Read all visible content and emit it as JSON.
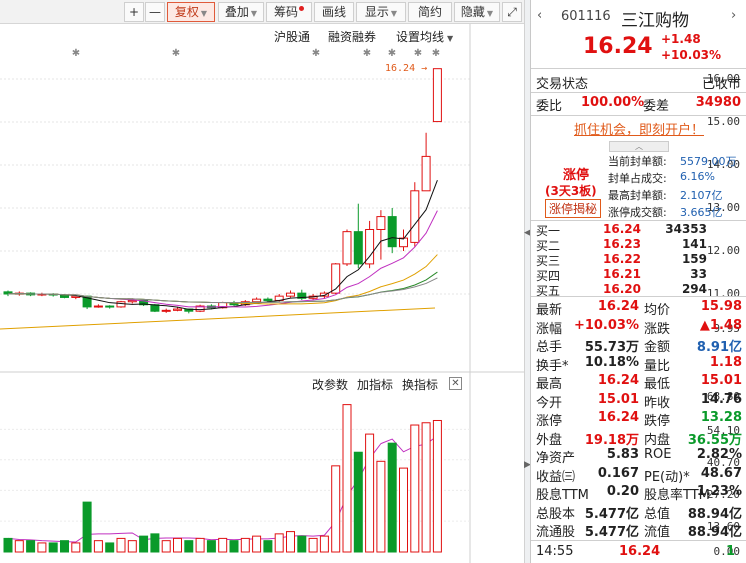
{
  "toolbar": {
    "plus": "+",
    "minus": "—",
    "fuquan": "复权",
    "diejia": "叠加",
    "chouma": "筹码",
    "huaxian": "画线",
    "xianshi": "显示",
    "jianyue": "简约",
    "yincang": "隐藏",
    "expand": "⤢"
  },
  "chart_links": {
    "hgt": "沪股通",
    "rzrq": "融资融券",
    "avg_setting": "设置均线"
  },
  "price_axis": [
    "16.00",
    "15.00",
    "14.00",
    "13.00",
    "12.00",
    "11.00",
    "9.95"
  ],
  "max_price_label": "16.24",
  "volume_buttons": {
    "params": "改参数",
    "add": "加指标",
    "change": "换指标",
    "close": "✕"
  },
  "volume_axis": [
    "68.80",
    "54.10",
    "40.70",
    "27.20",
    "13.60",
    "0.00"
  ],
  "stock": {
    "code": "601116",
    "name": "三江购物",
    "price": "16.24",
    "change": "+1.48",
    "change_pct": "+10.03%"
  },
  "status": {
    "label": "交易状态",
    "value": "已收市"
  },
  "weibi": {
    "label1": "委比",
    "value1": "100.00%",
    "label2": "委差",
    "value2": "34980"
  },
  "promo": "抓住机会，即刻开户！",
  "limit": {
    "tag": "涨停",
    "board": "(3天3板)",
    "reveal": "涨停揭秘",
    "items": [
      {
        "label": "当前封单额:",
        "value": "5579.00万"
      },
      {
        "label": "封单占成交:",
        "value": "6.16%"
      },
      {
        "label": "最高封单额:",
        "value": "2.107亿"
      },
      {
        "label": "涨停成交额:",
        "value": "3.665亿"
      }
    ]
  },
  "bids": [
    {
      "label": "买一",
      "price": "16.24",
      "vol": "34353"
    },
    {
      "label": "买二",
      "price": "16.23",
      "vol": "141"
    },
    {
      "label": "买三",
      "price": "16.22",
      "vol": "159"
    },
    {
      "label": "买四",
      "price": "16.21",
      "vol": "33"
    },
    {
      "label": "买五",
      "price": "16.20",
      "vol": "294"
    }
  ],
  "quote": [
    {
      "l1": "最新",
      "v1": "16.24",
      "c1": "red",
      "l2": "均价",
      "v2": "15.98",
      "c2": "red"
    },
    {
      "l1": "涨幅",
      "v1": "+10.03%",
      "c1": "red",
      "l2": "涨跌",
      "v2": "▲1.48",
      "c2": "red"
    },
    {
      "l1": "总手",
      "v1": "55.73万",
      "c1": "",
      "l2": "金额",
      "v2": "8.91亿",
      "c2": "blu"
    },
    {
      "l1": "换手*",
      "v1": "10.18%",
      "c1": "",
      "l2": "量比",
      "v2": "1.18",
      "c2": "red"
    },
    {
      "l1": "最高",
      "v1": "16.24",
      "c1": "red",
      "l2": "最低",
      "v2": "15.01",
      "c2": "red"
    },
    {
      "l1": "今开",
      "v1": "15.01",
      "c1": "red",
      "l2": "昨收",
      "v2": "14.76",
      "c2": ""
    },
    {
      "l1": "涨停",
      "v1": "16.24",
      "c1": "red",
      "l2": "跌停",
      "v2": "13.28",
      "c2": "grn"
    },
    {
      "l1": "外盘",
      "v1": "19.18万",
      "c1": "red",
      "l2": "内盘",
      "v2": "36.55万",
      "c2": "grn"
    },
    {
      "l1": "净资产",
      "v1": "5.83",
      "c1": "",
      "l2": "ROE",
      "v2": "2.82%",
      "c2": ""
    },
    {
      "l1": "收益㈢",
      "v1": "0.167",
      "c1": "",
      "l2": "PE(动)*",
      "v2": "48.67",
      "c2": ""
    },
    {
      "l1": "股息TTM",
      "v1": "0.20",
      "c1": "",
      "l2": "股息率TTM",
      "v2": "1.23%",
      "c2": ""
    },
    {
      "l1": "总股本",
      "v1": "5.477亿",
      "c1": "",
      "l2": "总值",
      "v2": "88.94亿",
      "c2": ""
    },
    {
      "l1": "流通股",
      "v1": "5.477亿",
      "c1": "",
      "l2": "流值",
      "v2": "88.94亿",
      "c2": ""
    }
  ],
  "tick": {
    "time": "14:55",
    "price": "16.24",
    "vol": "1"
  },
  "colors": {
    "up": "#e01010",
    "down": "#0a9a2a",
    "ma5": "#111111",
    "ma10": "#c030c0",
    "ma20": "#e0a000"
  }
}
